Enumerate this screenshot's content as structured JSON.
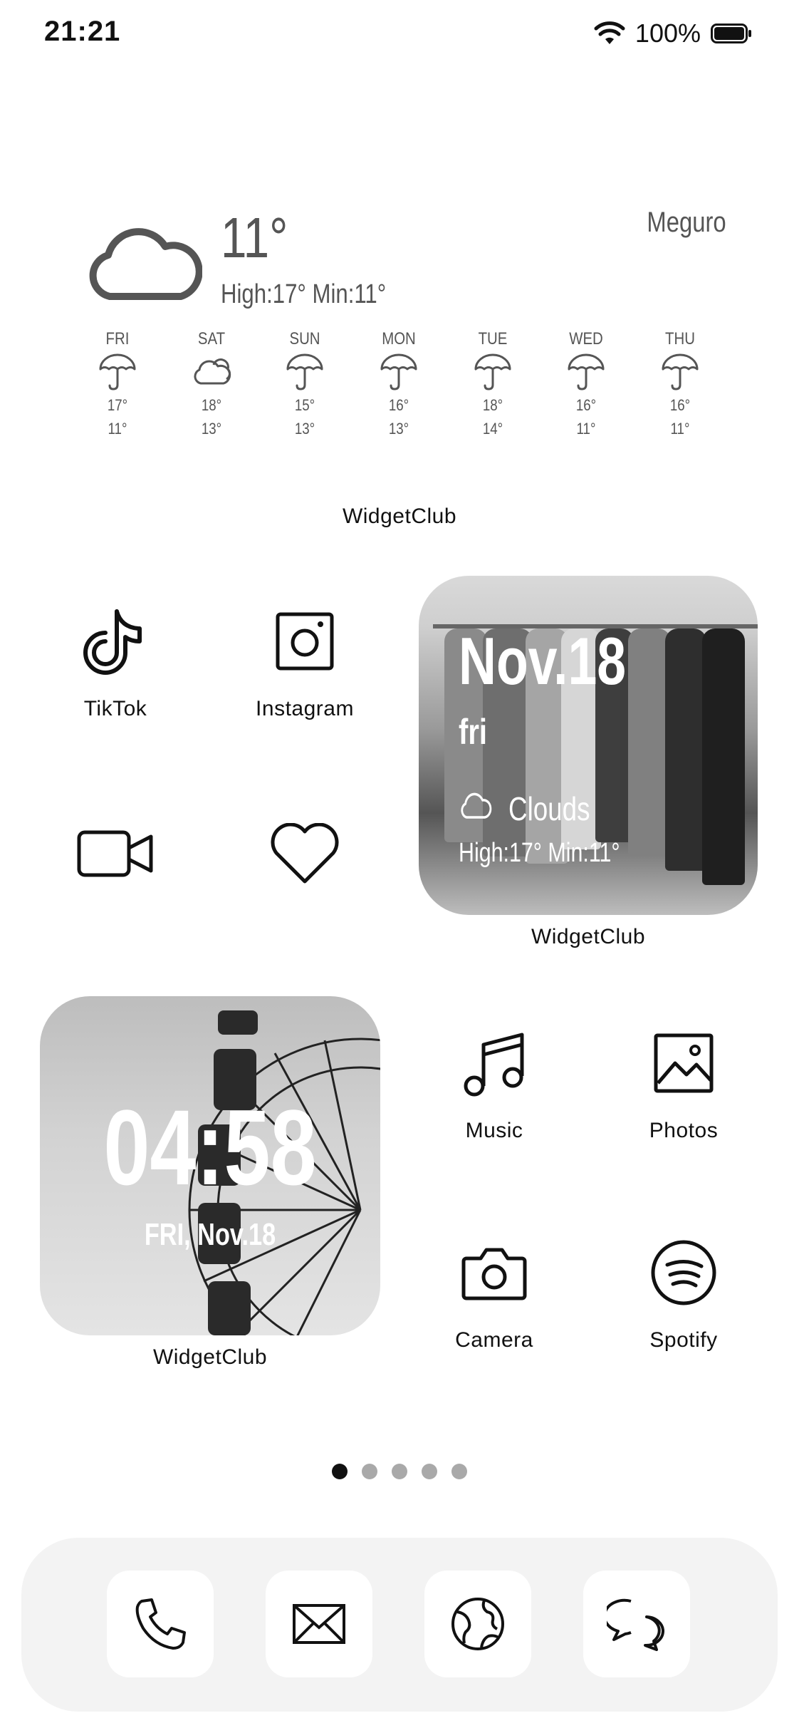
{
  "status": {
    "time": "21:21",
    "battery": "100%"
  },
  "weather": {
    "temp": "11°",
    "hilo": "High:17° Min:11°",
    "location": "Meguro",
    "forecast": [
      {
        "day": "FRI",
        "icon": "umbrella-icon",
        "high": "17°",
        "low": "11°"
      },
      {
        "day": "SAT",
        "icon": "cloud-icon",
        "high": "18°",
        "low": "13°"
      },
      {
        "day": "SUN",
        "icon": "umbrella-icon",
        "high": "15°",
        "low": "13°"
      },
      {
        "day": "MON",
        "icon": "umbrella-icon",
        "high": "16°",
        "low": "13°"
      },
      {
        "day": "TUE",
        "icon": "umbrella-icon",
        "high": "18°",
        "low": "14°"
      },
      {
        "day": "WED",
        "icon": "umbrella-icon",
        "high": "16°",
        "low": "11°"
      },
      {
        "day": "THU",
        "icon": "umbrella-icon",
        "high": "16°",
        "low": "11°"
      }
    ],
    "label": "WidgetClub"
  },
  "apps": {
    "tiktok": "TikTok",
    "instagram": "Instagram",
    "music": "Music",
    "photos": "Photos",
    "camera": "Camera",
    "spotify": "Spotify"
  },
  "clothes_widget": {
    "date": "Nov.18",
    "day": "fri",
    "condition": "Clouds",
    "hilo": "High:17° Min:11°",
    "label": "WidgetClub"
  },
  "clock_widget": {
    "time": "04:58",
    "date": "FRI, Nov.18",
    "label": "WidgetClub"
  },
  "page_dots": {
    "count": 5,
    "active": 0
  },
  "dock": [
    "phone-icon",
    "mail-icon",
    "globe-icon",
    "messages-icon"
  ]
}
